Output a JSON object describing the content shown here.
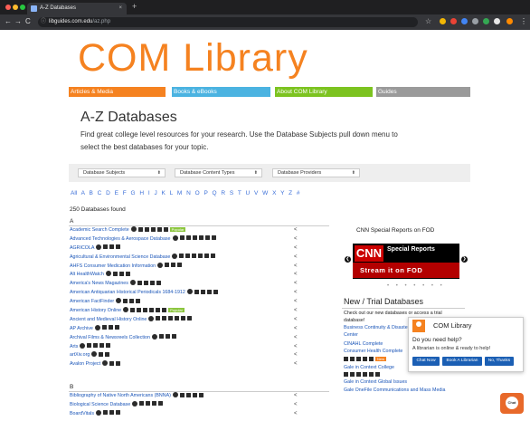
{
  "browser": {
    "tab_title": "A-Z Databases",
    "tab_close": "×",
    "new_tab": "+",
    "url_host": "libguides.com.edu",
    "url_path": "/az.php",
    "back": "←",
    "forward": "→",
    "reload": "C"
  },
  "logo": "COM Library",
  "nav": [
    "Articles & Media",
    "Books & eBooks",
    "About COM Library",
    "Guides"
  ],
  "nav_colors": [
    "#f58220",
    "#4bb3e1",
    "#7cc320",
    "#9a9a9a"
  ],
  "page_title": "A-Z Databases",
  "intro_text": "Find great college level resources for your research. Use the Database Subjects pull down menu to select the best databases for your topic.",
  "filters": [
    "Database Subjects",
    "Database Content Types",
    "Database Providers"
  ],
  "alphabet": "All A B C D E F G H I J K L M N O P Q R S T U V W X Y Z #",
  "found_text": "250 Databases found",
  "section_a": "A",
  "section_b": "B",
  "db_a": [
    {
      "name": "Academic Search Complete",
      "icons": 5,
      "tag": "Popular"
    },
    {
      "name": "Advanced Technologies & Aerospace Database",
      "icons": 6,
      "tag": ""
    },
    {
      "name": "AGRICOLA",
      "icons": 3,
      "tag": ""
    },
    {
      "name": "Agricultural & Environmental Science Database",
      "icons": 6,
      "tag": ""
    },
    {
      "name": "AHFS Consumer Medication Information",
      "icons": 3,
      "tag": ""
    },
    {
      "name": "Alt HealthWatch",
      "icons": 3,
      "tag": ""
    },
    {
      "name": "America's News Magazines",
      "icons": 4,
      "tag": ""
    },
    {
      "name": "American Antiquarian Historical Periodicals 1684-1912",
      "icons": 4,
      "tag": ""
    },
    {
      "name": "American FactFinder",
      "icons": 3,
      "tag": ""
    },
    {
      "name": "American History Online",
      "icons": 6,
      "tag": "Popular"
    },
    {
      "name": "Ancient and Medieval History Online",
      "icons": 6,
      "tag": ""
    },
    {
      "name": "AP Archive",
      "icons": 3,
      "tag": ""
    },
    {
      "name": "Archival Films & Newsreels Collection",
      "icons": 3,
      "tag": ""
    },
    {
      "name": "Arts",
      "icons": 4,
      "tag": ""
    },
    {
      "name": "artXiv.org",
      "icons": 2,
      "tag": ""
    },
    {
      "name": "Avalon Project",
      "icons": 2,
      "tag": ""
    }
  ],
  "db_b": [
    {
      "name": "Bibliography of Native North Americans (BNNA)",
      "icons": 4,
      "tag": ""
    },
    {
      "name": "Biological Science Database",
      "icons": 4,
      "tag": ""
    },
    {
      "name": "BoardVitals",
      "icons": 3,
      "tag": ""
    }
  ],
  "share_glyph": "<",
  "cnn": {
    "heading": "CNN Special Reports on FOD",
    "logo": "CNN",
    "special": "Special Reports",
    "stream": "Stream it on FOD",
    "prev": "❮",
    "next": "❯",
    "dots": "• • • • • • •"
  },
  "new_trial": {
    "title": "New / Trial Databases",
    "intro1": "Check out our new databases or access a trial",
    "intro2": "database!",
    "items": [
      "Business Continuity & Disaster Recovery",
      "Center",
      "CINAHL Complete",
      "Consumer Health Complete",
      "Gale in Context College",
      "Gale in Context Global Issues",
      "Gale OneFile Communications and Mass Media"
    ],
    "new_badge": "New"
  },
  "chat": {
    "name": "COM Library",
    "help": "Do you need help?",
    "message": "A librarian is online & ready to help!",
    "buttons": [
      "Chat Now",
      "Book A Librarian",
      "No, Thanks"
    ],
    "bubble": "Chat"
  }
}
